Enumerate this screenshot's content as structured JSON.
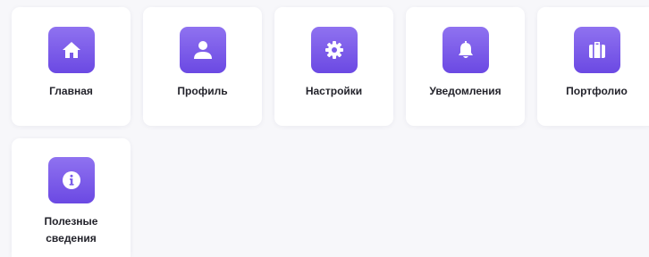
{
  "menu": {
    "items": [
      {
        "label": "Главная",
        "icon": "home-icon"
      },
      {
        "label": "Профиль",
        "icon": "user-icon"
      },
      {
        "label": "Настройки",
        "icon": "gear-icon"
      },
      {
        "label": "Уведомления",
        "icon": "bell-icon"
      },
      {
        "label": "Портфолио",
        "icon": "briefcase-icon"
      },
      {
        "label_line1": "Полезные",
        "label_line2": "сведения",
        "icon": "info-icon"
      }
    ]
  },
  "colors": {
    "accent_top": "#8f72f0",
    "accent_bottom": "#6b49e3",
    "tile_background": "#ffffff",
    "page_background": "#f7f7fa",
    "label_text": "#23232b"
  }
}
